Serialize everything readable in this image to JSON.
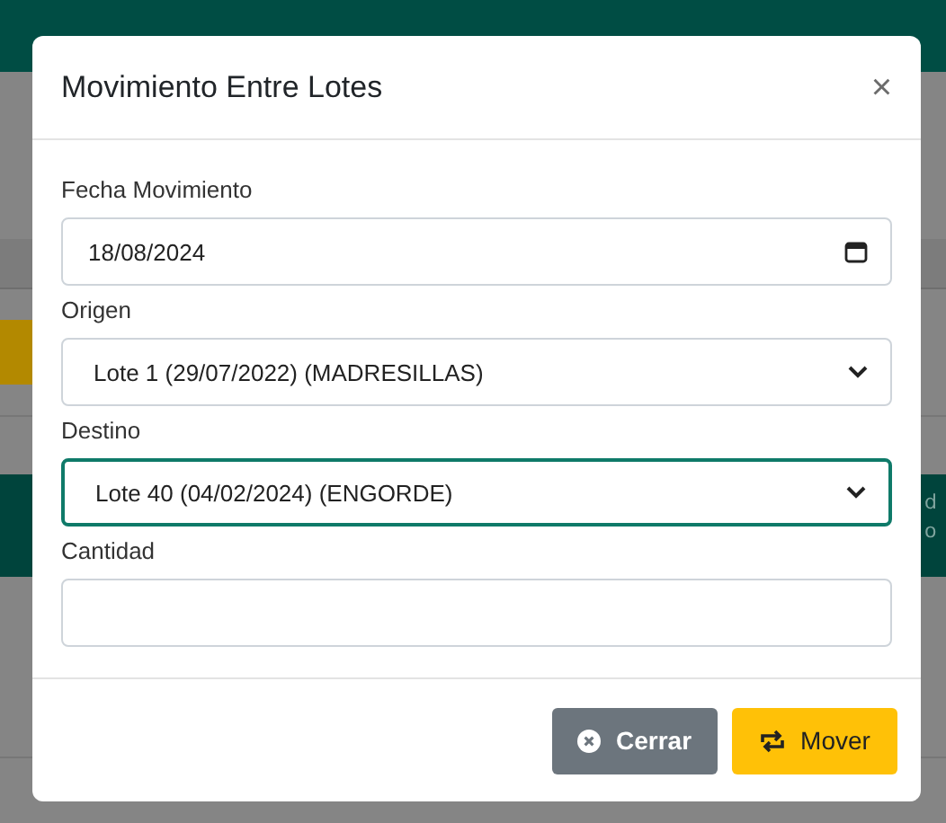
{
  "background": {
    "table_header": [
      "d",
      "o"
    ]
  },
  "modal": {
    "title": "Movimiento Entre Lotes",
    "close": "×",
    "fields": [
      {
        "kind": "date",
        "label": "Fecha Movimiento",
        "value": "18/08/2024",
        "focused": false
      },
      {
        "kind": "select",
        "label": "Origen",
        "value": "Lote 1 (29/07/2022) (MADRESILLAS)",
        "focused": false
      },
      {
        "kind": "select",
        "label": "Destino",
        "value": "Lote 40 (04/02/2024) (ENGORDE)",
        "focused": true
      },
      {
        "kind": "text",
        "label": "Cantidad",
        "focused": false
      }
    ],
    "buttons": [
      {
        "kind": "secondary",
        "label": "Cerrar"
      },
      {
        "kind": "primary",
        "label": "Mover"
      }
    ]
  }
}
